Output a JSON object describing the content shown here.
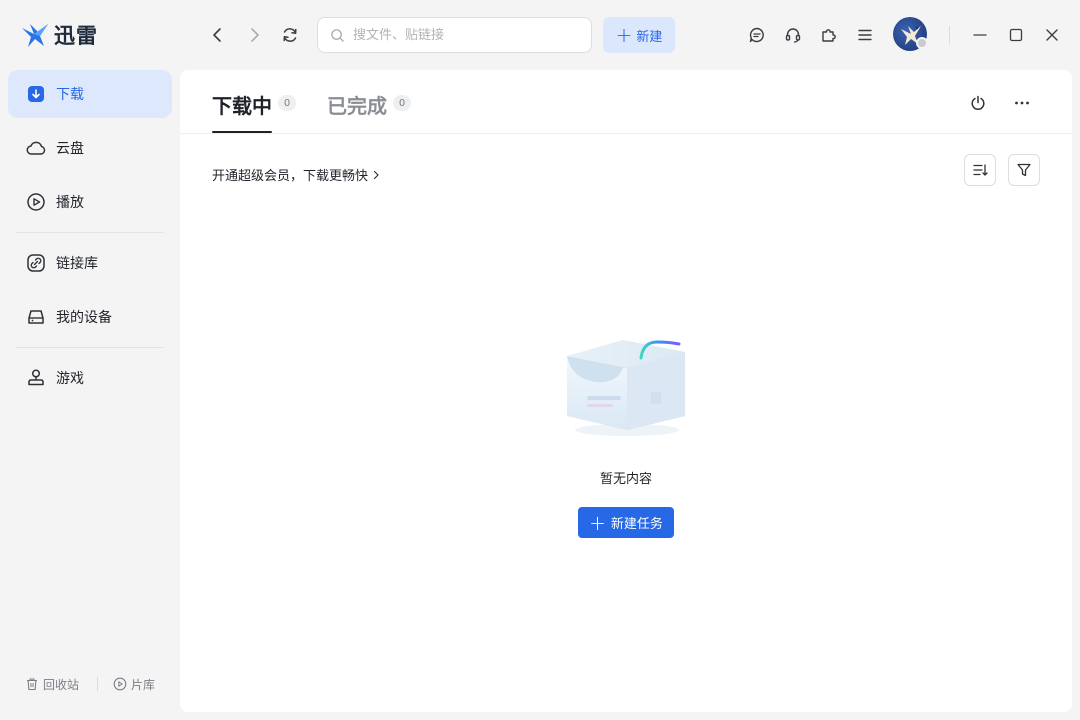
{
  "app": {
    "name": "迅雷"
  },
  "search": {
    "placeholder": "搜文件、贴链接"
  },
  "toolbar": {
    "new_label": "新建"
  },
  "sidebar": {
    "items": [
      {
        "label": "下载"
      },
      {
        "label": "云盘"
      },
      {
        "label": "播放"
      },
      {
        "label": "链接库"
      },
      {
        "label": "我的设备"
      },
      {
        "label": "游戏"
      }
    ],
    "bottom": {
      "recycle_label": "回收站",
      "library_label": "片库"
    }
  },
  "tabs": [
    {
      "label": "下载中",
      "count": "0"
    },
    {
      "label": "已完成",
      "count": "0"
    }
  ],
  "promo": {
    "text": "开通超级会员，下载更畅快"
  },
  "empty": {
    "text": "暂无内容",
    "button_label": "新建任务"
  },
  "colors": {
    "accent": "#2668e6",
    "accent_light": "#dde8fc",
    "background": "#f4f4f5"
  }
}
